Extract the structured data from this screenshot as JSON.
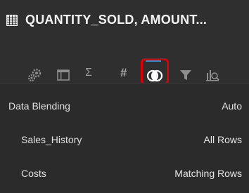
{
  "header": {
    "title": "QUANTITY_SOLD, AMOUNT..."
  },
  "toolbar": {
    "tools": [
      {
        "name": "settings",
        "icon": "gears-icon"
      },
      {
        "name": "layout",
        "icon": "window-icon"
      },
      {
        "name": "sum",
        "icon": "sigma-icon",
        "glyph": "Σ"
      },
      {
        "name": "number",
        "icon": "hash-icon",
        "glyph": "#"
      },
      {
        "name": "data-blending",
        "icon": "blend-circles-icon",
        "active": true
      },
      {
        "name": "filter",
        "icon": "filter-icon"
      },
      {
        "name": "analytics",
        "icon": "chart-magnifier-icon"
      }
    ],
    "active_color": "#2d8fd6",
    "highlight_color": "#e00000"
  },
  "properties": [
    {
      "label": "Data Blending",
      "value": "Auto"
    },
    {
      "label": "Sales_History",
      "value": "All Rows"
    },
    {
      "label": "Costs",
      "value": "Matching Rows"
    }
  ]
}
